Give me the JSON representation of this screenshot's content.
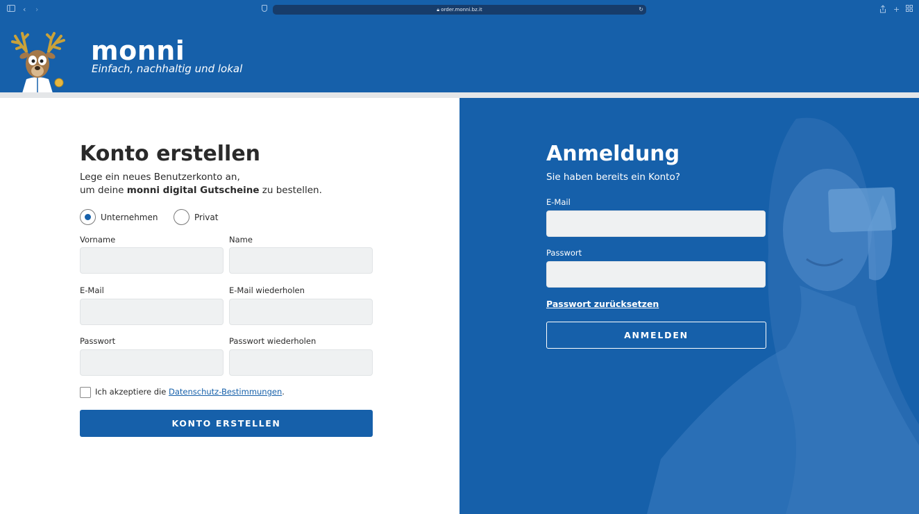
{
  "browser": {
    "url": "order.monni.bz.it",
    "lock_icon": "lock-icon"
  },
  "header": {
    "brand": "monni",
    "tagline": "Einfach, nachhaltig und lokal"
  },
  "register": {
    "title": "Konto erstellen",
    "desc_line1": "Lege ein neues Benutzerkonto an,",
    "desc_pre": "um deine ",
    "desc_bold": "monni digital Gutscheine",
    "desc_post": " zu bestellen.",
    "radio_company": "Unternehmen",
    "radio_private": "Privat",
    "selected": "Unternehmen",
    "label_firstname": "Vorname",
    "label_name": "Name",
    "label_email": "E-Mail",
    "label_email_repeat": "E-Mail wiederholen",
    "label_password": "Passwort",
    "label_password_repeat": "Passwort wiederholen",
    "accept_pre": "Ich akzeptiere die ",
    "accept_link": "Datenschutz-Bestimmungen",
    "accept_post": ".",
    "submit_label": "KONTO ERSTELLEN"
  },
  "login": {
    "title": "Anmeldung",
    "subtitle": "Sie haben bereits ein Konto?",
    "label_email": "E-Mail",
    "label_password": "Passwort",
    "reset_label": "Passwort zurücksetzen",
    "submit_label": "ANMELDEN"
  },
  "colors": {
    "brand_blue": "#1660aa",
    "field_bg": "#eff1f2",
    "divider": "#e4e6e8"
  }
}
